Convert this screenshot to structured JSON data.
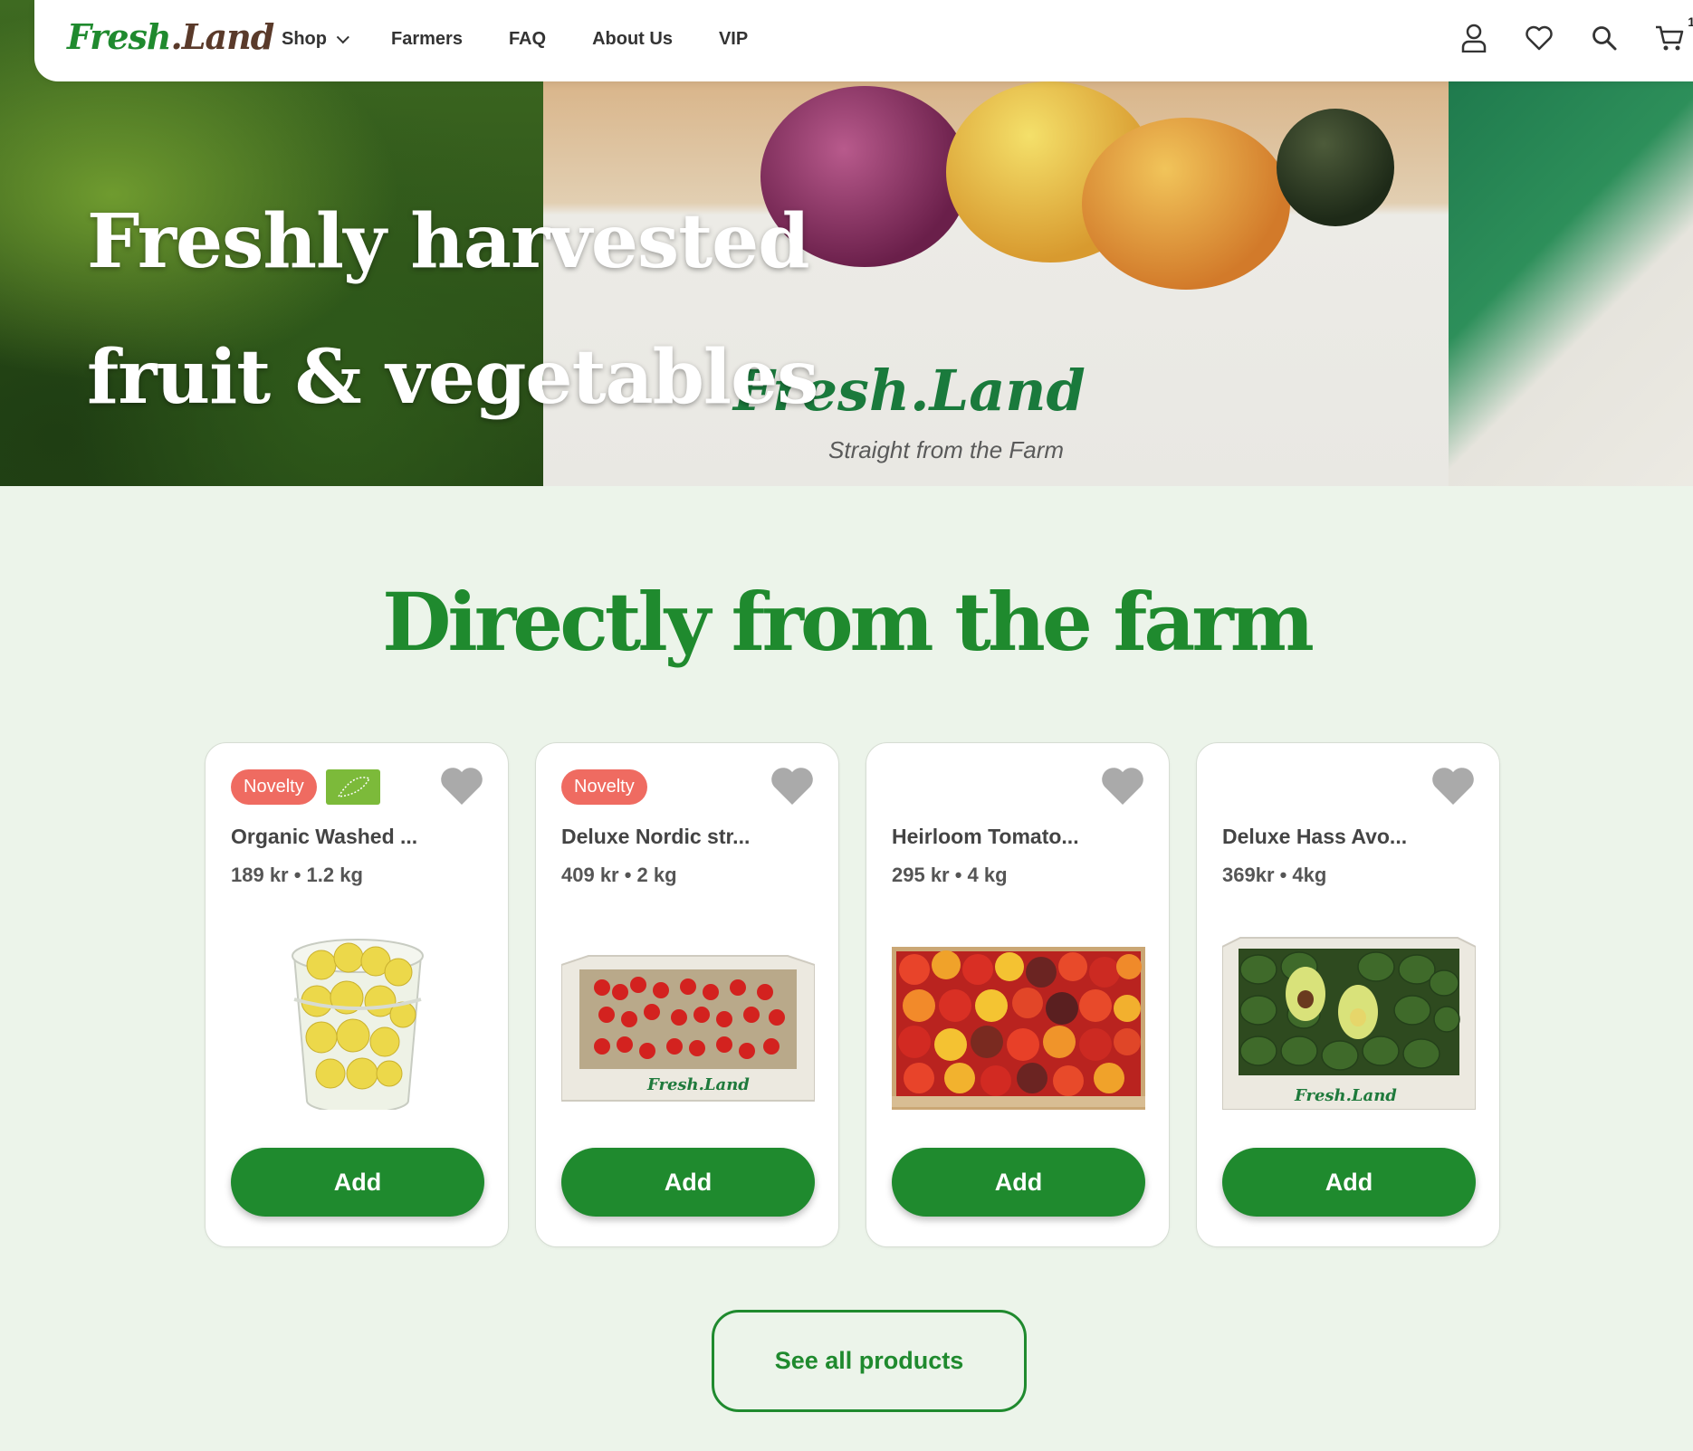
{
  "brand": {
    "logo_main": "Fresh",
    "logo_dot": ".Land",
    "crate_logo": "Fresh.Land",
    "crate_tagline": "Straight from the Farm"
  },
  "nav": {
    "links": [
      "Shop",
      "Farmers",
      "FAQ",
      "About Us",
      "VIP"
    ],
    "icons": [
      "user-icon",
      "heart-icon",
      "search-icon",
      "cart-icon"
    ],
    "cart_count": "1"
  },
  "hero": {
    "line1": "Freshly harvested",
    "line2": "fruit & vegetables"
  },
  "section": {
    "title": "Directly from the farm"
  },
  "products": [
    {
      "badge": "Novelty",
      "organic": true,
      "name": "Organic Washed ...",
      "meta": "189 kr • 1.2 kg",
      "add": "Add",
      "image": "lemons-bucket"
    },
    {
      "badge": "Novelty",
      "organic": false,
      "name": "Deluxe Nordic str...",
      "meta": "409 kr • 2 kg",
      "add": "Add",
      "image": "strawberries-box"
    },
    {
      "badge": "",
      "organic": false,
      "name": "Heirloom Tomato...",
      "meta": "295 kr • 4 kg",
      "add": "Add",
      "image": "tomatoes-crate"
    },
    {
      "badge": "",
      "organic": false,
      "name": "Deluxe Hass Avo...",
      "meta": "369kr • 4kg",
      "add": "Add",
      "image": "avocados-box"
    }
  ],
  "cta": {
    "see_all": "See all products"
  },
  "colors": {
    "brand_green": "#1f8a2e",
    "novelty_red": "#ef6b61",
    "page_bg": "#ecf4ea"
  }
}
